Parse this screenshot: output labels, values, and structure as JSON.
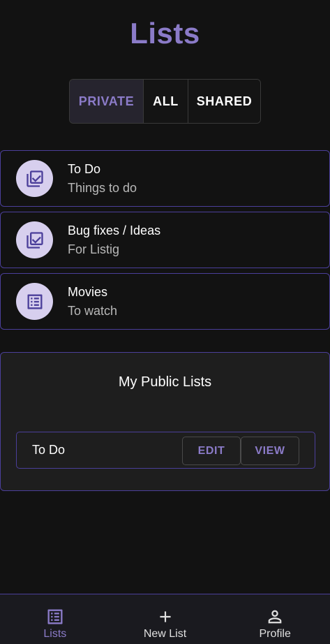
{
  "header": {
    "title": "Lists"
  },
  "filter_tabs": [
    {
      "label": "PRIVATE",
      "active": true
    },
    {
      "label": "ALL",
      "active": false
    },
    {
      "label": "SHARED",
      "active": false
    }
  ],
  "lists": [
    {
      "title": "To Do",
      "subtitle": "Things to do",
      "icon": "library-add-check-icon"
    },
    {
      "title": "Bug fixes / Ideas",
      "subtitle": "For Listig",
      "icon": "library-add-check-icon"
    },
    {
      "title": "Movies",
      "subtitle": "To watch",
      "icon": "list-alt-icon"
    }
  ],
  "public_lists": {
    "title": "My Public Lists",
    "items": [
      {
        "name": "To Do",
        "edit_label": "EDIT",
        "view_label": "VIEW"
      }
    ]
  },
  "bottom_nav": [
    {
      "label": "Lists",
      "icon": "list-alt-icon",
      "active": true
    },
    {
      "label": "New List",
      "icon": "plus-icon",
      "active": false
    },
    {
      "label": "Profile",
      "icon": "person-icon",
      "active": false
    }
  ],
  "colors": {
    "accent": "#8b7bc8",
    "background": "#121212",
    "border_accent": "#4b3f9a",
    "avatar_bg": "#d7cfee"
  }
}
